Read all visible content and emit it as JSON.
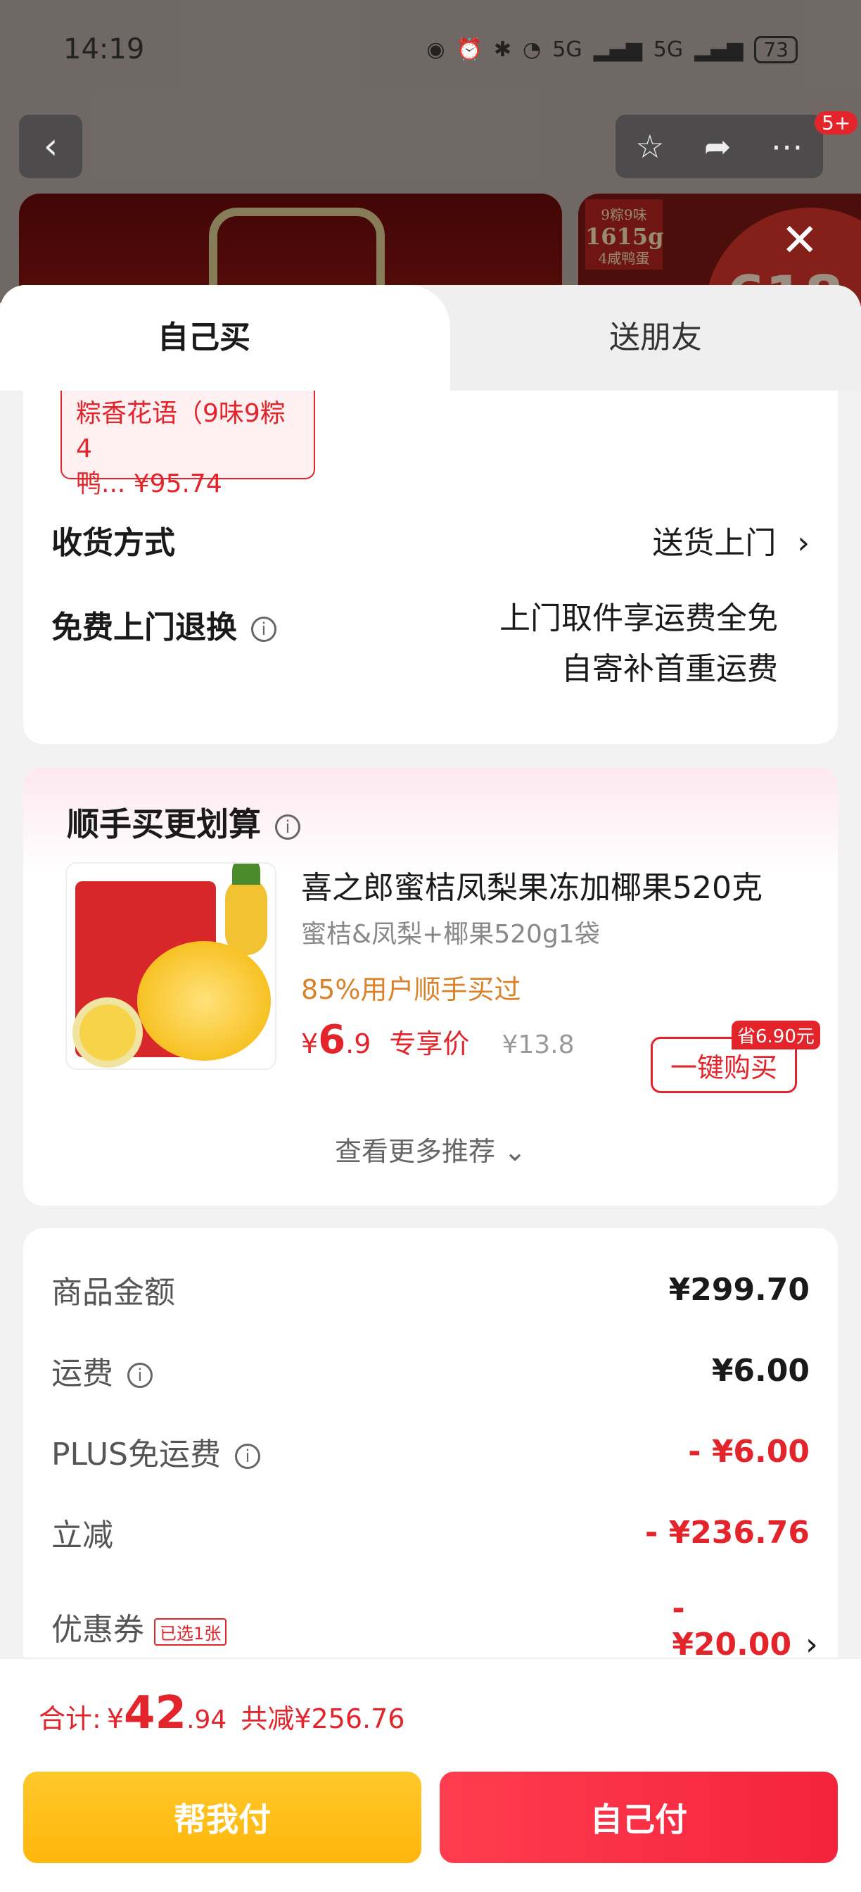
{
  "status_bar": {
    "time": "14:19",
    "network_1": "5G",
    "network_2": "5G",
    "battery": "73"
  },
  "header": {
    "badge": "5+"
  },
  "background_images": {
    "box_text_1": "9粽9味",
    "box_text_2": "1615g",
    "box_text_3": "4咸鸭蛋",
    "promo": "618"
  },
  "tabs": {
    "active": "自己买",
    "inactive": "送朋友"
  },
  "selected_sku": {
    "line1": "粽香花语（9味9粽4",
    "line2": "鸭... ¥95.74"
  },
  "delivery": {
    "label": "收货方式",
    "value": "送货上门"
  },
  "free_return": {
    "label": "免费上门退换",
    "line1": "上门取件享运费全免",
    "line2": "自寄补首重运费"
  },
  "recommend": {
    "title": "顺手买更划算",
    "product_name": "喜之郎蜜桔凤梨果冻加椰果520克",
    "spec": "蜜桔&凤梨+椰果520g1袋",
    "stat": "85%用户顺手买过",
    "price_symbol": "¥",
    "price_int": "6",
    "price_dec": ".9",
    "price_label": "专享价",
    "original_price": "¥13.8",
    "save_badge": "省6.90元",
    "buy_button": "一键购买",
    "more": "查看更多推荐"
  },
  "fees": [
    {
      "label": "商品金额",
      "amount": "¥299.70",
      "info": false,
      "red": false
    },
    {
      "label": "运费",
      "amount": "¥6.00",
      "info": true,
      "red": false
    },
    {
      "label": "PLUS免运费",
      "amount": "- ¥6.00",
      "info": true,
      "red": true
    },
    {
      "label": "立减",
      "amount": "- ¥236.76",
      "info": false,
      "red": true
    },
    {
      "label": "优惠券",
      "badge": "已选1张",
      "amount": "-¥20.00",
      "info": false,
      "red": true
    }
  ],
  "footer": {
    "total_label": "合计:",
    "total_symbol": "¥",
    "total_int": "42",
    "total_dec": ".94",
    "total_saved": "共减¥256.76",
    "help_pay": "帮我付",
    "self_pay": "自己付"
  },
  "colors": {
    "accent": "#e3242b",
    "yellow": "#ffc82a",
    "orange_text": "#d9822b"
  }
}
